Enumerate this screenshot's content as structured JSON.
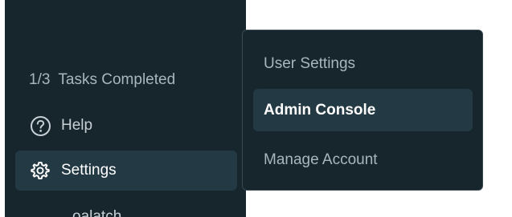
{
  "sidebar": {
    "tasks": {
      "count": "1/3",
      "label": "Tasks Completed"
    },
    "help": {
      "label": "Help",
      "icon": "help-circle-icon"
    },
    "settings": {
      "label": "Settings",
      "icon": "gear-icon"
    },
    "cutoff_item": {
      "label": "oalatch..."
    }
  },
  "settings_menu": {
    "items": [
      {
        "label": "User Settings"
      },
      {
        "label": "Admin Console"
      },
      {
        "label": "Manage Account"
      }
    ]
  },
  "colors": {
    "panel_bg": "#17252c",
    "active_bg": "#233943",
    "text_muted": "#a9b6bd",
    "text_active": "#ffffff",
    "page_bg": "#ffffff"
  }
}
